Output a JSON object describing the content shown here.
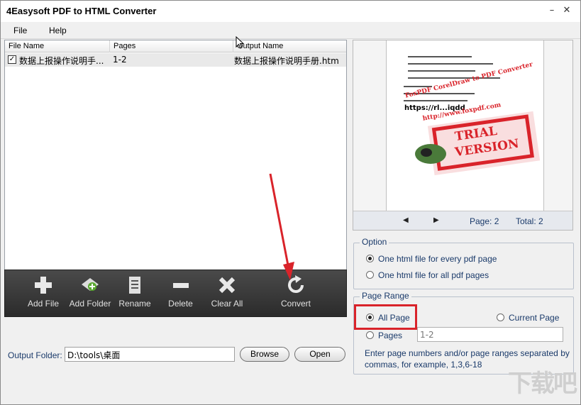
{
  "window": {
    "title": "4Easysoft PDF to HTML Converter",
    "minimize_glyph": "–",
    "close_glyph": "✕"
  },
  "menu": {
    "file": "File",
    "help": "Help"
  },
  "file_list": {
    "columns": [
      "File Name",
      "Pages",
      "Output Name"
    ],
    "rows": [
      {
        "checked": true,
        "checkmark": "✓",
        "file_name": "数据上报操作说明手...",
        "pages": "1-2",
        "output_name": "数据上报操作说明手册.htm"
      }
    ]
  },
  "toolbar": {
    "add_file": "Add File",
    "add_folder": "Add Folder",
    "rename": "Rename",
    "delete": "Delete",
    "clear_all": "Clear All",
    "convert": "Convert"
  },
  "output": {
    "label": "Output Folder:",
    "path": "D:\\tools\\桌面",
    "browse": "Browse",
    "open": "Open"
  },
  "preview": {
    "page_label": "Page: 2",
    "total_label": "Total: 2",
    "prev_glyph": "◀",
    "next_glyph": "▶",
    "doc_url": "https://rl...iqdd",
    "stamp_line1": "TRIAL",
    "stamp_line2": "VERSION",
    "stamp_arc": "FoxPDF CorelDraw to PDF Converter",
    "stamp_site": "http://www.foxpdf.com"
  },
  "option": {
    "title": "Option",
    "choices": [
      "One html file for every pdf page",
      "One html file for all pdf pages"
    ],
    "selected": 0
  },
  "page_range": {
    "title": "Page Range",
    "all_page": "All Page",
    "current_page": "Current Page",
    "pages": "Pages",
    "pages_value": "1-2",
    "selected": "All Page",
    "hint": "Enter page numbers and/or page ranges separated by commas, for example, 1,3,6-18"
  },
  "colors": {
    "accent_text": "#1a3a6a",
    "annotation_red": "#d9232a",
    "toolbar_bg": "#2b2b2b"
  },
  "watermark_text": "下载吧"
}
